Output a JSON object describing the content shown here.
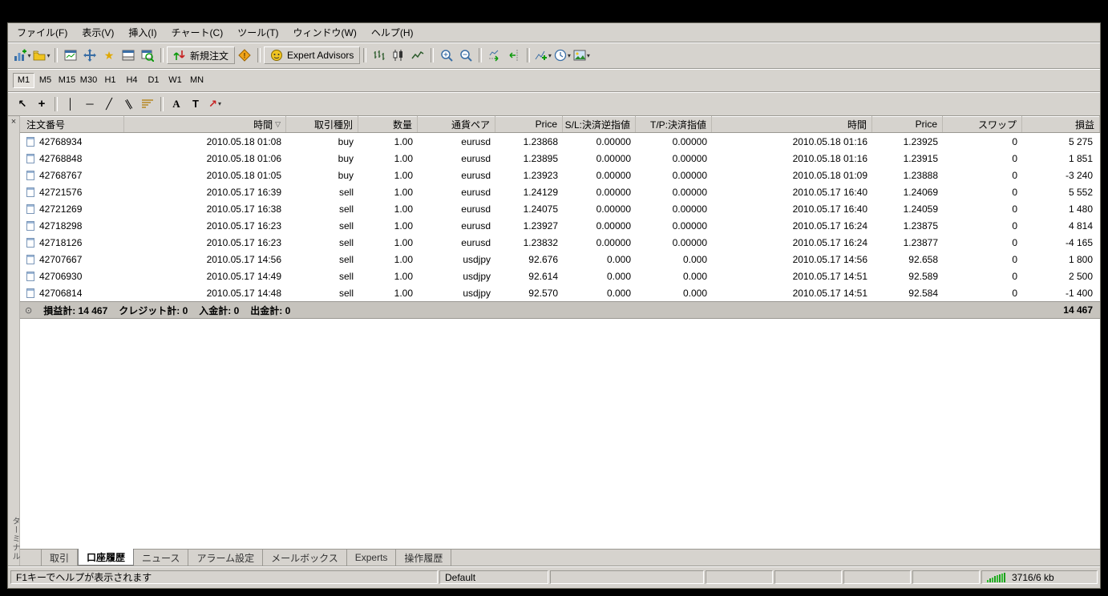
{
  "menu": {
    "items": [
      {
        "label": "ファイル(F)"
      },
      {
        "label": "表示(V)"
      },
      {
        "label": "挿入(I)"
      },
      {
        "label": "チャート(C)"
      },
      {
        "label": "ツール(T)"
      },
      {
        "label": "ウィンドウ(W)"
      },
      {
        "label": "ヘルプ(H)"
      }
    ]
  },
  "toolbar": {
    "new_order_label": "新規注文",
    "expert_advisors_label": "Expert Advisors"
  },
  "timeframes": {
    "items": [
      {
        "label": "M1",
        "active": true
      },
      {
        "label": "M5"
      },
      {
        "label": "M15"
      },
      {
        "label": "M30"
      },
      {
        "label": "H1"
      },
      {
        "label": "H4"
      },
      {
        "label": "D1"
      },
      {
        "label": "W1"
      },
      {
        "label": "MN"
      }
    ]
  },
  "icons": {
    "caret": "▾",
    "close": "×",
    "sort_desc": "▽",
    "navigator_star": "★",
    "summary_dot": "⊙",
    "cursor": "↖",
    "crosshair": "+",
    "vline": "│",
    "hline": "─",
    "trendline": "╱",
    "channel": "∥",
    "text_a": "A",
    "text_t": "T",
    "arrow_tool": "↗"
  },
  "terminal": {
    "panel_title": "ターミナル",
    "table": {
      "columns": [
        "注文番号",
        "時間",
        "取引種別",
        "数量",
        "通貨ペア",
        "Price",
        "S/L:決済逆指値",
        "T/P:決済指値",
        "時間",
        "Price",
        "スワップ",
        "損益"
      ],
      "rows": [
        {
          "order": "42768934",
          "open_time": "2010.05.18 01:08",
          "type": "buy",
          "size": "1.00",
          "symbol": "eurusd",
          "open_price": "1.23868",
          "sl": "0.00000",
          "tp": "0.00000",
          "close_time": "2010.05.18 01:16",
          "close_price": "1.23925",
          "swap": "0",
          "profit": "5 275"
        },
        {
          "order": "42768848",
          "open_time": "2010.05.18 01:06",
          "type": "buy",
          "size": "1.00",
          "symbol": "eurusd",
          "open_price": "1.23895",
          "sl": "0.00000",
          "tp": "0.00000",
          "close_time": "2010.05.18 01:16",
          "close_price": "1.23915",
          "swap": "0",
          "profit": "1 851"
        },
        {
          "order": "42768767",
          "open_time": "2010.05.18 01:05",
          "type": "buy",
          "size": "1.00",
          "symbol": "eurusd",
          "open_price": "1.23923",
          "sl": "0.00000",
          "tp": "0.00000",
          "close_time": "2010.05.18 01:09",
          "close_price": "1.23888",
          "swap": "0",
          "profit": "-3 240"
        },
        {
          "order": "42721576",
          "open_time": "2010.05.17 16:39",
          "type": "sell",
          "size": "1.00",
          "symbol": "eurusd",
          "open_price": "1.24129",
          "sl": "0.00000",
          "tp": "0.00000",
          "close_time": "2010.05.17 16:40",
          "close_price": "1.24069",
          "swap": "0",
          "profit": "5 552"
        },
        {
          "order": "42721269",
          "open_time": "2010.05.17 16:38",
          "type": "sell",
          "size": "1.00",
          "symbol": "eurusd",
          "open_price": "1.24075",
          "sl": "0.00000",
          "tp": "0.00000",
          "close_time": "2010.05.17 16:40",
          "close_price": "1.24059",
          "swap": "0",
          "profit": "1 480"
        },
        {
          "order": "42718298",
          "open_time": "2010.05.17 16:23",
          "type": "sell",
          "size": "1.00",
          "symbol": "eurusd",
          "open_price": "1.23927",
          "sl": "0.00000",
          "tp": "0.00000",
          "close_time": "2010.05.17 16:24",
          "close_price": "1.23875",
          "swap": "0",
          "profit": "4 814"
        },
        {
          "order": "42718126",
          "open_time": "2010.05.17 16:23",
          "type": "sell",
          "size": "1.00",
          "symbol": "eurusd",
          "open_price": "1.23832",
          "sl": "0.00000",
          "tp": "0.00000",
          "close_time": "2010.05.17 16:24",
          "close_price": "1.23877",
          "swap": "0",
          "profit": "-4 165"
        },
        {
          "order": "42707667",
          "open_time": "2010.05.17 14:56",
          "type": "sell",
          "size": "1.00",
          "symbol": "usdjpy",
          "open_price": "92.676",
          "sl": "0.000",
          "tp": "0.000",
          "close_time": "2010.05.17 14:56",
          "close_price": "92.658",
          "swap": "0",
          "profit": "1 800"
        },
        {
          "order": "42706930",
          "open_time": "2010.05.17 14:49",
          "type": "sell",
          "size": "1.00",
          "symbol": "usdjpy",
          "open_price": "92.614",
          "sl": "0.000",
          "tp": "0.000",
          "close_time": "2010.05.17 14:51",
          "close_price": "92.589",
          "swap": "0",
          "profit": "2 500"
        },
        {
          "order": "42706814",
          "open_time": "2010.05.17 14:48",
          "type": "sell",
          "size": "1.00",
          "symbol": "usdjpy",
          "open_price": "92.570",
          "sl": "0.000",
          "tp": "0.000",
          "close_time": "2010.05.17 14:51",
          "close_price": "92.584",
          "swap": "0",
          "profit": "-1 400"
        }
      ],
      "summary": {
        "profit_label": "損益計: 14 467",
        "credit_label": "クレジット計: 0",
        "deposit_label": "入金計: 0",
        "withdrawal_label": "出金計: 0",
        "total": "14 467"
      }
    },
    "tabs": [
      {
        "label": "取引"
      },
      {
        "label": "口座履歴",
        "active": true
      },
      {
        "label": "ニュース"
      },
      {
        "label": "アラーム設定"
      },
      {
        "label": "メールボックス"
      },
      {
        "label": "Experts"
      },
      {
        "label": "操作履歴"
      }
    ]
  },
  "statusbar": {
    "help": "F1キーでヘルプが表示されます",
    "profile": "Default",
    "traffic": "3716/6 kb"
  }
}
